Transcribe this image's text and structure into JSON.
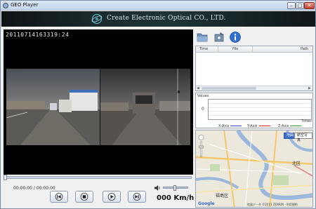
{
  "window": {
    "title": "GEO Player",
    "min_glyph": "–",
    "max_glyph": "□",
    "close_glyph": "✕"
  },
  "banner": {
    "company": "Create Electronic Optical CO., LTD."
  },
  "video": {
    "timestamp": "20110714163319:24"
  },
  "playback": {
    "time_readout": "00:00:00 / 00:00:00",
    "progress": 0,
    "volume": 0.45,
    "speed": "000 Km/h"
  },
  "icons": {
    "window": "app-icon",
    "toolbar": [
      "folder-icon",
      "settings-icon",
      "info-icon"
    ],
    "controls": [
      "skip-back-icon",
      "stop-icon",
      "play-icon",
      "skip-forward-icon"
    ],
    "volume": "speaker-icon"
  },
  "filelist": {
    "columns": [
      "Time",
      "File",
      "Path"
    ],
    "rows": []
  },
  "graph": {
    "values_label": "Values",
    "zero_label": "0",
    "time_label": "Times",
    "legend": [
      {
        "label": "X-Axis",
        "color": "#2a3fd0"
      },
      {
        "label": "Y-Axis",
        "color": "#e02020"
      },
      {
        "label": "Z-Axis",
        "color": "#20a020"
      }
    ]
  },
  "map": {
    "buttons": [
      "地図",
      "航空写真"
    ],
    "labels": [
      "北区",
      "福島区"
    ],
    "credit": "地図データ ©2011 ZENRIN - 利用規約",
    "brand": "Google"
  },
  "colors": {
    "banner_bg": "#1b2a2d",
    "accent": "#3a6ec8"
  }
}
